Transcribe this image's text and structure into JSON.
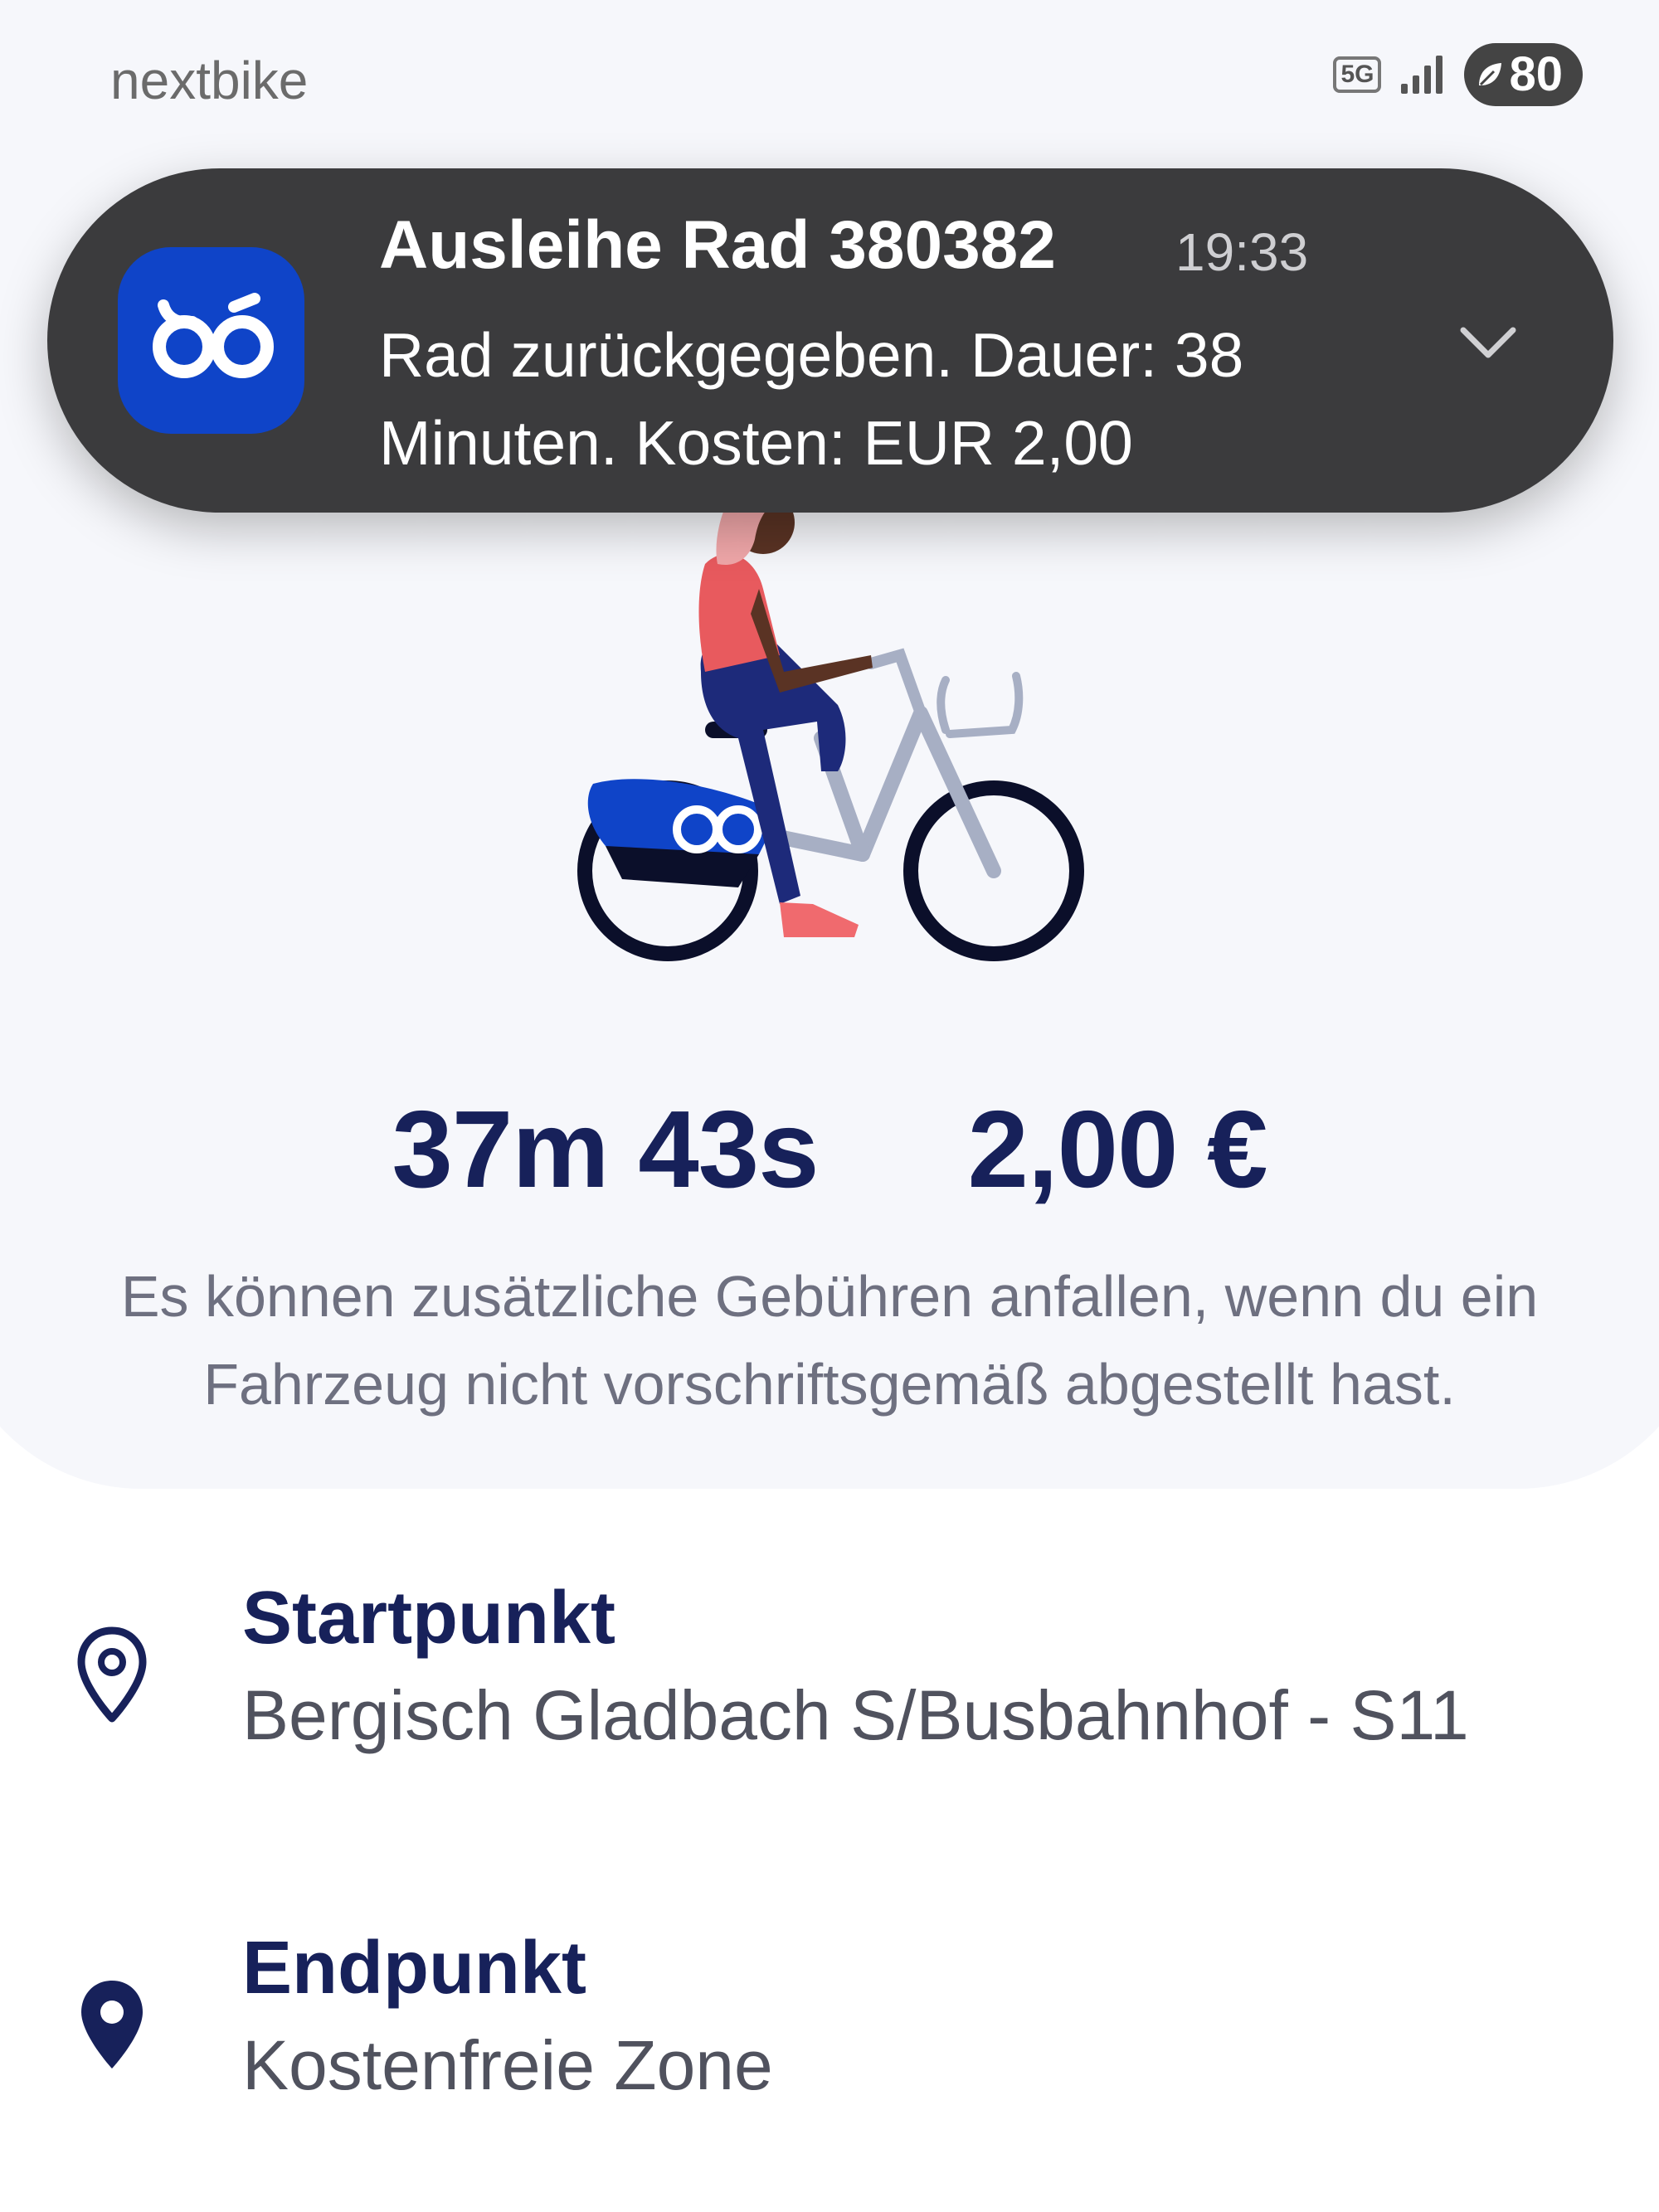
{
  "status_bar": {
    "app_name": "nextbike",
    "network": "5G",
    "battery": "80",
    "icons": [
      "5g-icon",
      "signal-icon",
      "battery-icon"
    ]
  },
  "notification": {
    "app_icon": "nextbike-logo-icon",
    "title": "Ausleihe Rad 380382",
    "time": "19:33",
    "body": "Rad zurückgegeben. Dauer: 38 Minuten. Kosten: EUR 2,00",
    "expand_icon": "chevron-down-icon"
  },
  "ride_summary": {
    "duration": "37m 43s",
    "cost": "2,00 €",
    "fee_note": "Es können zusätzliche Gebühren anfallen, wenn du ein Fahrzeug nicht vorschriftsgemäß abgestellt hast."
  },
  "locations": {
    "start": {
      "title": "Startpunkt",
      "value": "Bergisch Gladbach S/Busbahnhof - S11",
      "icon": "pin-outline-icon"
    },
    "end": {
      "title": "Endpunkt",
      "value": "Kostenfreie Zone",
      "icon": "pin-filled-icon"
    }
  },
  "colors": {
    "brand_blue": "#0f44c8",
    "navy_text": "#17215a",
    "notification_bg": "#3b3b3d",
    "hero_bg": "#f6f7fb"
  }
}
